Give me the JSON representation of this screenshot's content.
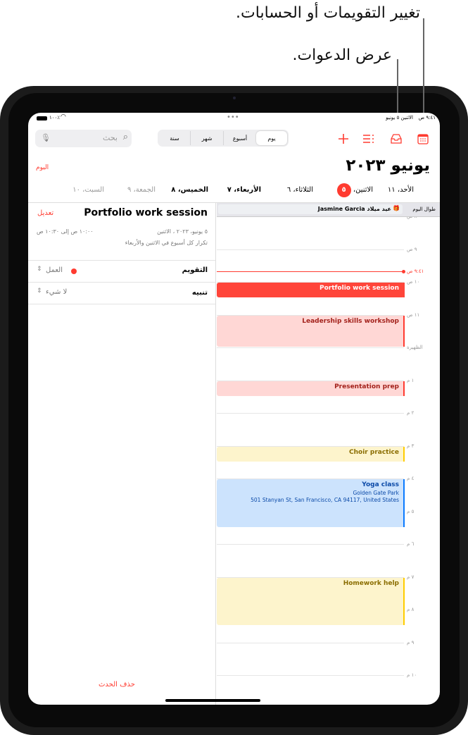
{
  "callouts": {
    "change_calendars": "تغيير التقويمات أو الحسابات.",
    "show_invitations": "عرض الدعوات."
  },
  "status_bar": {
    "time": "٩:٤١ ص",
    "date": "الاثنين ٥ يونيو",
    "battery": "٪١٠٠"
  },
  "toolbar": {
    "search_placeholder": "بحث",
    "views": [
      "يوم",
      "أسبوع",
      "شهر",
      "سنة"
    ],
    "selected_view": "يوم",
    "icons": [
      "calendar-icon",
      "inbox-icon",
      "list-icon",
      "plus-icon",
      "search-icon",
      "mic-icon"
    ]
  },
  "header": {
    "title": "يونيو ٢٠٢٣",
    "today_button": "اليوم"
  },
  "week": [
    {
      "label": "الأحد، ١١",
      "style": "normal"
    },
    {
      "label": "الاثنين،",
      "badge": "٥",
      "style": "selected"
    },
    {
      "label": "الثلاثاء، ٦",
      "style": "normal"
    },
    {
      "label": "الأربعاء، ٧",
      "style": "bold"
    },
    {
      "label": "الخميس، ٨",
      "style": "bold"
    },
    {
      "label": "الجمعة، ٩",
      "style": "gray"
    },
    {
      "label": "السبت، ١٠",
      "style": "gray"
    }
  ],
  "detail": {
    "title": "Portfolio work session",
    "edit": "تعديل",
    "date": "٥ يونيو، ٢٠٢٣ ، الاثنين",
    "time": "١٠:٠٠ ص إلى ١٠:٣٠ ص",
    "repeat": "تكرار كل أسبوع في الاثنين والأربعاء",
    "calendar_label": "التقويم",
    "calendar_value": "العمل",
    "calendar_color": "#ff3b30",
    "alert_label": "تنبيه",
    "alert_value": "لا شيء",
    "delete": "حذف الحدث"
  },
  "day_view": {
    "all_day_label": "طوال اليوم",
    "all_day_event": "عيد ميلاد Jasmine Garcia",
    "now_label": "٩:٤١ ص",
    "now": 9.683,
    "hours": [
      {
        "h": 8,
        "label": "٨ ص"
      },
      {
        "h": 9,
        "label": "٩ ص"
      },
      {
        "h": 10,
        "label": "١٠ ص"
      },
      {
        "h": 11,
        "label": "١١ ص"
      },
      {
        "h": 12,
        "label": "الظهيرة"
      },
      {
        "h": 13,
        "label": "١ م"
      },
      {
        "h": 14,
        "label": "٢ م"
      },
      {
        "h": 15,
        "label": "٣ م"
      },
      {
        "h": 16,
        "label": "٤ م"
      },
      {
        "h": 17,
        "label": "٥ م"
      },
      {
        "h": 18,
        "label": "٦ م"
      },
      {
        "h": 19,
        "label": "٧ م"
      },
      {
        "h": 20,
        "label": "٨ م"
      },
      {
        "h": 21,
        "label": "٩ م"
      },
      {
        "h": 22,
        "label": "١٠ م"
      }
    ],
    "events": [
      {
        "title": "Portfolio work session",
        "start": 10,
        "end": 10.5,
        "bg": "#ff453a",
        "fg": "#ffffff",
        "bar": "#ff453a"
      },
      {
        "title": "Leadership skills workshop",
        "start": 11,
        "end": 12,
        "bg": "#ffd7d5",
        "fg": "#a3221c",
        "bar": "#ff3b30"
      },
      {
        "title": "Presentation prep",
        "start": 13,
        "end": 13.5,
        "bg": "#ffd7d5",
        "fg": "#a3221c",
        "bar": "#ff3b30"
      },
      {
        "title": "Choir practice",
        "start": 15,
        "end": 15.5,
        "bg": "#fdf4cc",
        "fg": "#8a6d00",
        "bar": "#ffcc00"
      },
      {
        "title": "Yoga class",
        "start": 16,
        "end": 17.5,
        "bg": "#cce3fd",
        "fg": "#0b4aa8",
        "bar": "#0a7aff",
        "location": "Golden Gate Park",
        "address": "501 Stanyan St, San Francisco, CA 94117, United States"
      },
      {
        "title": "Homework help",
        "start": 19,
        "end": 20.5,
        "bg": "#fdf4cc",
        "fg": "#8a6d00",
        "bar": "#ffcc00"
      }
    ]
  }
}
